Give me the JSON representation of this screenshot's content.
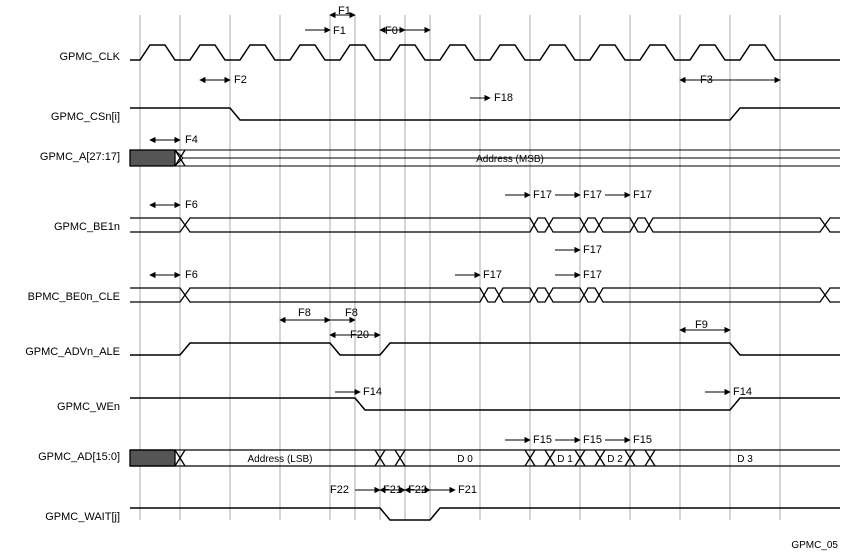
{
  "signals": {
    "clk": "GPMC_CLK",
    "csn": "GPMC_CSn[i]",
    "a": "GPMC_A[27:17]",
    "be1n": "GPMC_BE1n",
    "be0n": "BPMC_BE0n_CLE",
    "advn": "GPMC_ADVn_ALE",
    "wen": "GPMC_WEn",
    "ad": "GPMC_AD[15:0]",
    "wait": "GPMC_WAIT[j]"
  },
  "timing_labels": {
    "F0": "F0",
    "F1": "F1",
    "F1b": "F1",
    "F2": "F2",
    "F3": "F3",
    "F4": "F4",
    "F6a": "F6",
    "F6b": "F6",
    "F8a": "F8",
    "F8b": "F8",
    "F9": "F9",
    "F14a": "F14",
    "F14b": "F14",
    "F15a": "F15",
    "F15b": "F15",
    "F15c": "F15",
    "F17a": "F17",
    "F17b": "F17",
    "F17c": "F17",
    "F17d": "F17",
    "F17e": "F17",
    "F17f": "F17",
    "F18": "F18",
    "F20": "F20",
    "F21a": "F21",
    "F21b": "F21",
    "F22a": "F22",
    "F22b": "F22"
  },
  "bus": {
    "a_msb": "Address (MSB)",
    "ad_lsb": "Address (LSB)",
    "d0": "D 0",
    "d1": "D 1",
    "d2": "D 2",
    "d3": "D 3"
  },
  "footer": "GPMC_05"
}
